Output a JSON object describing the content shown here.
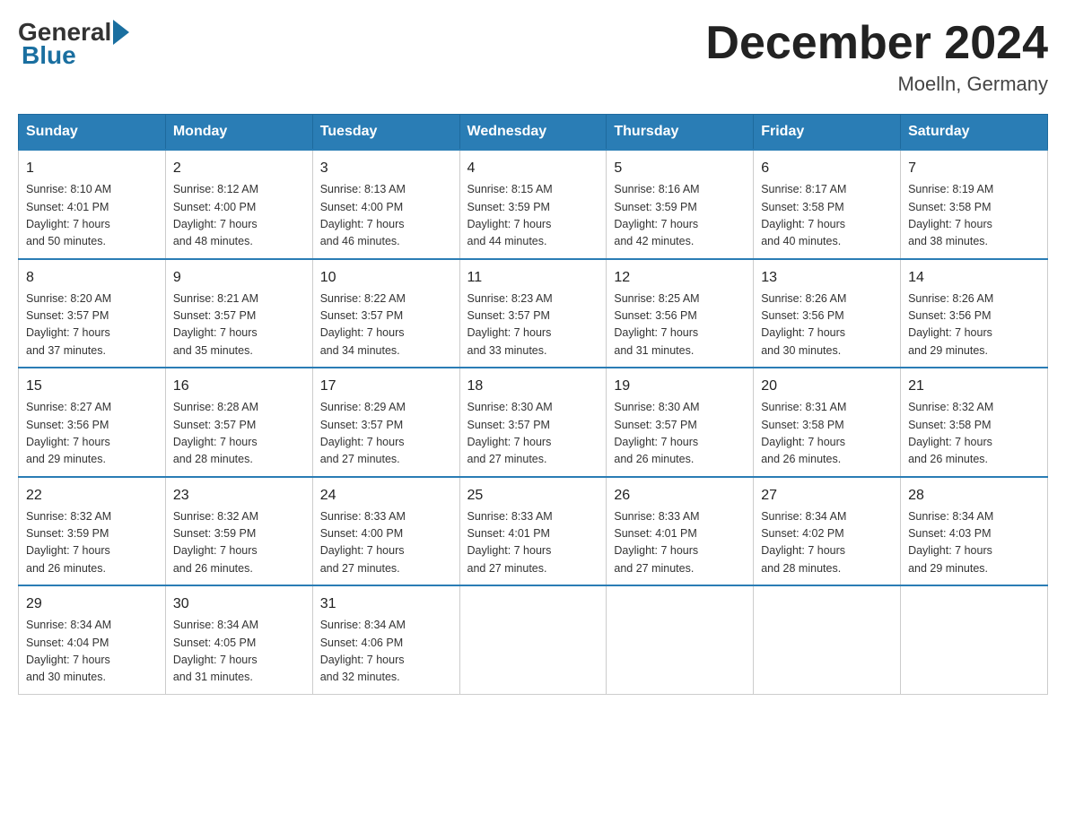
{
  "logo": {
    "general": "General",
    "blue": "Blue"
  },
  "header": {
    "title": "December 2024",
    "subtitle": "Moelln, Germany"
  },
  "weekdays": [
    "Sunday",
    "Monday",
    "Tuesday",
    "Wednesday",
    "Thursday",
    "Friday",
    "Saturday"
  ],
  "weeks": [
    [
      {
        "day": "1",
        "sunrise": "8:10 AM",
        "sunset": "4:01 PM",
        "daylight": "7 hours and 50 minutes."
      },
      {
        "day": "2",
        "sunrise": "8:12 AM",
        "sunset": "4:00 PM",
        "daylight": "7 hours and 48 minutes."
      },
      {
        "day": "3",
        "sunrise": "8:13 AM",
        "sunset": "4:00 PM",
        "daylight": "7 hours and 46 minutes."
      },
      {
        "day": "4",
        "sunrise": "8:15 AM",
        "sunset": "3:59 PM",
        "daylight": "7 hours and 44 minutes."
      },
      {
        "day": "5",
        "sunrise": "8:16 AM",
        "sunset": "3:59 PM",
        "daylight": "7 hours and 42 minutes."
      },
      {
        "day": "6",
        "sunrise": "8:17 AM",
        "sunset": "3:58 PM",
        "daylight": "7 hours and 40 minutes."
      },
      {
        "day": "7",
        "sunrise": "8:19 AM",
        "sunset": "3:58 PM",
        "daylight": "7 hours and 38 minutes."
      }
    ],
    [
      {
        "day": "8",
        "sunrise": "8:20 AM",
        "sunset": "3:57 PM",
        "daylight": "7 hours and 37 minutes."
      },
      {
        "day": "9",
        "sunrise": "8:21 AM",
        "sunset": "3:57 PM",
        "daylight": "7 hours and 35 minutes."
      },
      {
        "day": "10",
        "sunrise": "8:22 AM",
        "sunset": "3:57 PM",
        "daylight": "7 hours and 34 minutes."
      },
      {
        "day": "11",
        "sunrise": "8:23 AM",
        "sunset": "3:57 PM",
        "daylight": "7 hours and 33 minutes."
      },
      {
        "day": "12",
        "sunrise": "8:25 AM",
        "sunset": "3:56 PM",
        "daylight": "7 hours and 31 minutes."
      },
      {
        "day": "13",
        "sunrise": "8:26 AM",
        "sunset": "3:56 PM",
        "daylight": "7 hours and 30 minutes."
      },
      {
        "day": "14",
        "sunrise": "8:26 AM",
        "sunset": "3:56 PM",
        "daylight": "7 hours and 29 minutes."
      }
    ],
    [
      {
        "day": "15",
        "sunrise": "8:27 AM",
        "sunset": "3:56 PM",
        "daylight": "7 hours and 29 minutes."
      },
      {
        "day": "16",
        "sunrise": "8:28 AM",
        "sunset": "3:57 PM",
        "daylight": "7 hours and 28 minutes."
      },
      {
        "day": "17",
        "sunrise": "8:29 AM",
        "sunset": "3:57 PM",
        "daylight": "7 hours and 27 minutes."
      },
      {
        "day": "18",
        "sunrise": "8:30 AM",
        "sunset": "3:57 PM",
        "daylight": "7 hours and 27 minutes."
      },
      {
        "day": "19",
        "sunrise": "8:30 AM",
        "sunset": "3:57 PM",
        "daylight": "7 hours and 26 minutes."
      },
      {
        "day": "20",
        "sunrise": "8:31 AM",
        "sunset": "3:58 PM",
        "daylight": "7 hours and 26 minutes."
      },
      {
        "day": "21",
        "sunrise": "8:32 AM",
        "sunset": "3:58 PM",
        "daylight": "7 hours and 26 minutes."
      }
    ],
    [
      {
        "day": "22",
        "sunrise": "8:32 AM",
        "sunset": "3:59 PM",
        "daylight": "7 hours and 26 minutes."
      },
      {
        "day": "23",
        "sunrise": "8:32 AM",
        "sunset": "3:59 PM",
        "daylight": "7 hours and 26 minutes."
      },
      {
        "day": "24",
        "sunrise": "8:33 AM",
        "sunset": "4:00 PM",
        "daylight": "7 hours and 27 minutes."
      },
      {
        "day": "25",
        "sunrise": "8:33 AM",
        "sunset": "4:01 PM",
        "daylight": "7 hours and 27 minutes."
      },
      {
        "day": "26",
        "sunrise": "8:33 AM",
        "sunset": "4:01 PM",
        "daylight": "7 hours and 27 minutes."
      },
      {
        "day": "27",
        "sunrise": "8:34 AM",
        "sunset": "4:02 PM",
        "daylight": "7 hours and 28 minutes."
      },
      {
        "day": "28",
        "sunrise": "8:34 AM",
        "sunset": "4:03 PM",
        "daylight": "7 hours and 29 minutes."
      }
    ],
    [
      {
        "day": "29",
        "sunrise": "8:34 AM",
        "sunset": "4:04 PM",
        "daylight": "7 hours and 30 minutes."
      },
      {
        "day": "30",
        "sunrise": "8:34 AM",
        "sunset": "4:05 PM",
        "daylight": "7 hours and 31 minutes."
      },
      {
        "day": "31",
        "sunrise": "8:34 AM",
        "sunset": "4:06 PM",
        "daylight": "7 hours and 32 minutes."
      },
      null,
      null,
      null,
      null
    ]
  ]
}
